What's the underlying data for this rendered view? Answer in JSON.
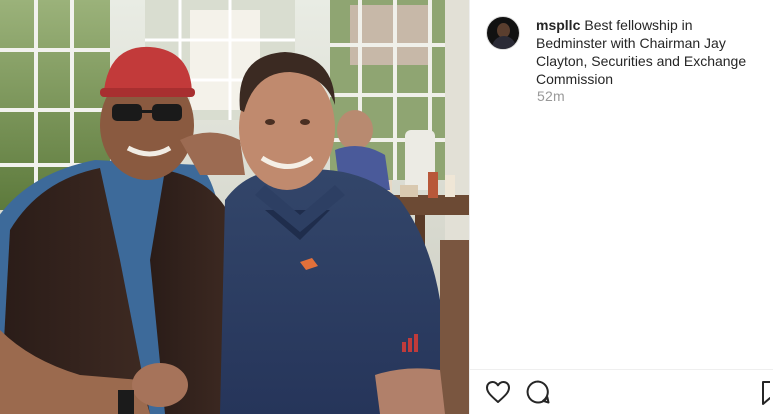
{
  "post": {
    "username": "mspllc",
    "caption": "Best fellowship in Bedminster with Chairman Jay Clayton, Securities and Exchange Commission",
    "timestamp": "52m"
  },
  "icons": {
    "like": "heart-icon",
    "comment": "comment-icon",
    "save": "bookmark-icon"
  },
  "colors": {
    "text": "#262626",
    "muted": "#999999",
    "divider": "#efefef"
  }
}
